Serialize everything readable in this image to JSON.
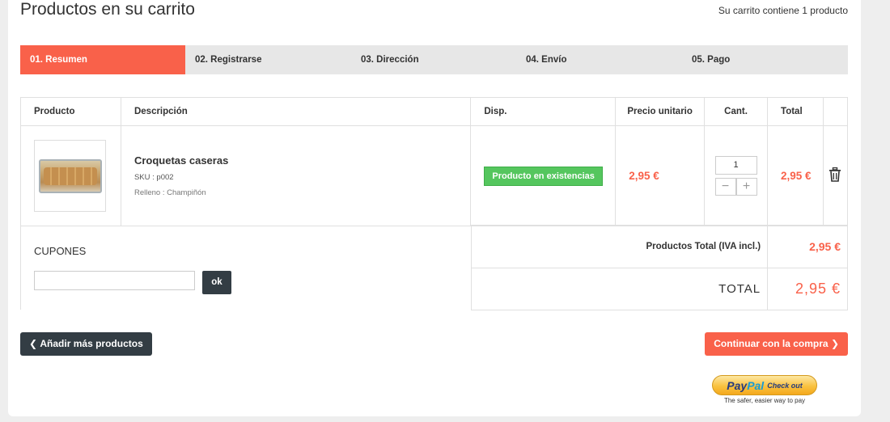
{
  "header": {
    "title": "Productos en su carrito",
    "summary": "Su carrito contiene 1 producto"
  },
  "steps": [
    {
      "label": "01. Resumen",
      "active": true
    },
    {
      "label": "02. Registrarse",
      "active": false
    },
    {
      "label": "03. Dirección",
      "active": false
    },
    {
      "label": "04. Envío",
      "active": false
    },
    {
      "label": "05. Pago",
      "active": false
    }
  ],
  "table": {
    "headers": [
      "Producto",
      "Descripción",
      "Disp.",
      "Precio unitario",
      "Cant.",
      "Total"
    ],
    "rows": [
      {
        "name": "Croquetas caseras",
        "sku": "SKU : p002",
        "option": "Relleno : Champiñón",
        "availability": "Producto en existencias",
        "unit_price": "2,95 €",
        "quantity": "1",
        "total": "2,95 €",
        "qty_minus": "−",
        "qty_plus": "+"
      }
    ]
  },
  "coupons": {
    "title": "CUPONES",
    "input_value": "",
    "button": "ok"
  },
  "totals": {
    "products_label": "Productos Total (IVA incl.)",
    "products_value": "2,95 €",
    "total_label": "TOTAL",
    "total_value": "2,95 €"
  },
  "actions": {
    "back": "Añadir más productos",
    "next": "Continuar con la compra"
  },
  "paypal": {
    "word_a": "Pay",
    "word_b": "Pal",
    "checkout": "Check out",
    "tagline": "The safer, easier way to pay"
  },
  "colors": {
    "accent": "#f9614a",
    "dark_button": "#333d44",
    "stock_green": "#55c65e"
  }
}
